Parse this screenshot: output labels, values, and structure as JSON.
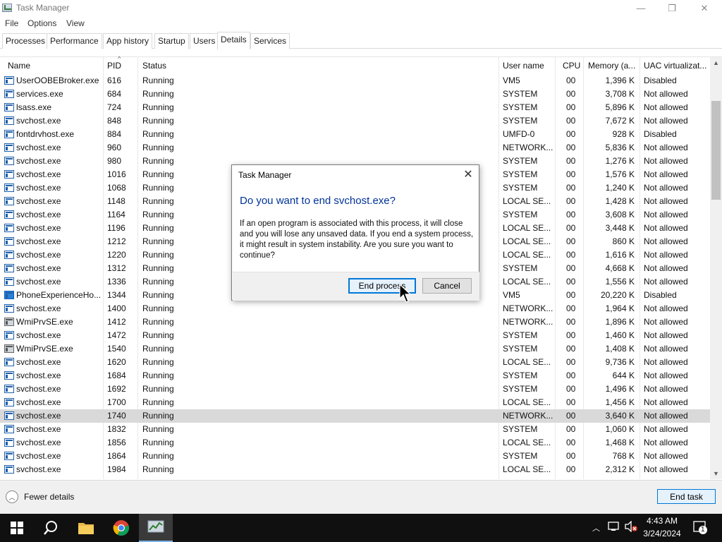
{
  "window": {
    "title": "Task Manager",
    "minimize": "—",
    "restore": "❐",
    "close": "✕"
  },
  "menu": [
    "File",
    "Options",
    "View"
  ],
  "tabs": [
    "Processes",
    "Performance",
    "App history",
    "Startup",
    "Users",
    "Details",
    "Services"
  ],
  "active_tab": "Details",
  "columns": {
    "name": "Name",
    "pid": "PID",
    "status": "Status",
    "user": "User name",
    "cpu": "CPU",
    "memory": "Memory (a...",
    "uac": "UAC virtualizat..."
  },
  "rows": [
    {
      "name": "UserOOBEBroker.exe",
      "pid": "616",
      "status": "Running",
      "user": "VM5",
      "cpu": "00",
      "memory": "1,396 K",
      "uac": "Disabled"
    },
    {
      "name": "services.exe",
      "pid": "684",
      "status": "Running",
      "user": "SYSTEM",
      "cpu": "00",
      "memory": "3,708 K",
      "uac": "Not allowed"
    },
    {
      "name": "lsass.exe",
      "pid": "724",
      "status": "Running",
      "user": "SYSTEM",
      "cpu": "00",
      "memory": "5,896 K",
      "uac": "Not allowed"
    },
    {
      "name": "svchost.exe",
      "pid": "848",
      "status": "Running",
      "user": "SYSTEM",
      "cpu": "00",
      "memory": "7,672 K",
      "uac": "Not allowed"
    },
    {
      "name": "fontdrvhost.exe",
      "pid": "884",
      "status": "Running",
      "user": "UMFD-0",
      "cpu": "00",
      "memory": "928 K",
      "uac": "Disabled"
    },
    {
      "name": "svchost.exe",
      "pid": "960",
      "status": "Running",
      "user": "NETWORK...",
      "cpu": "00",
      "memory": "5,836 K",
      "uac": "Not allowed"
    },
    {
      "name": "svchost.exe",
      "pid": "980",
      "status": "Running",
      "user": "SYSTEM",
      "cpu": "00",
      "memory": "1,276 K",
      "uac": "Not allowed"
    },
    {
      "name": "svchost.exe",
      "pid": "1016",
      "status": "Running",
      "user": "SYSTEM",
      "cpu": "00",
      "memory": "1,576 K",
      "uac": "Not allowed"
    },
    {
      "name": "svchost.exe",
      "pid": "1068",
      "status": "Running",
      "user": "SYSTEM",
      "cpu": "00",
      "memory": "1,240 K",
      "uac": "Not allowed"
    },
    {
      "name": "svchost.exe",
      "pid": "1148",
      "status": "Running",
      "user": "LOCAL SE...",
      "cpu": "00",
      "memory": "1,428 K",
      "uac": "Not allowed"
    },
    {
      "name": "svchost.exe",
      "pid": "1164",
      "status": "Running",
      "user": "SYSTEM",
      "cpu": "00",
      "memory": "3,608 K",
      "uac": "Not allowed"
    },
    {
      "name": "svchost.exe",
      "pid": "1196",
      "status": "Running",
      "user": "LOCAL SE...",
      "cpu": "00",
      "memory": "3,448 K",
      "uac": "Not allowed"
    },
    {
      "name": "svchost.exe",
      "pid": "1212",
      "status": "Running",
      "user": "LOCAL SE...",
      "cpu": "00",
      "memory": "860 K",
      "uac": "Not allowed"
    },
    {
      "name": "svchost.exe",
      "pid": "1220",
      "status": "Running",
      "user": "LOCAL SE...",
      "cpu": "00",
      "memory": "1,616 K",
      "uac": "Not allowed"
    },
    {
      "name": "svchost.exe",
      "pid": "1312",
      "status": "Running",
      "user": "SYSTEM",
      "cpu": "00",
      "memory": "4,668 K",
      "uac": "Not allowed"
    },
    {
      "name": "svchost.exe",
      "pid": "1336",
      "status": "Running",
      "user": "LOCAL SE...",
      "cpu": "00",
      "memory": "1,556 K",
      "uac": "Not allowed"
    },
    {
      "name": "PhoneExperienceHo...",
      "pid": "1344",
      "status": "Running",
      "user": "VM5",
      "cpu": "00",
      "memory": "20,220 K",
      "uac": "Disabled",
      "icon": "phone"
    },
    {
      "name": "svchost.exe",
      "pid": "1400",
      "status": "Running",
      "user": "NETWORK...",
      "cpu": "00",
      "memory": "1,964 K",
      "uac": "Not allowed"
    },
    {
      "name": "WmiPrvSE.exe",
      "pid": "1412",
      "status": "Running",
      "user": "NETWORK...",
      "cpu": "00",
      "memory": "1,896 K",
      "uac": "Not allowed",
      "icon": "wmi"
    },
    {
      "name": "svchost.exe",
      "pid": "1472",
      "status": "Running",
      "user": "SYSTEM",
      "cpu": "00",
      "memory": "1,460 K",
      "uac": "Not allowed"
    },
    {
      "name": "WmiPrvSE.exe",
      "pid": "1540",
      "status": "Running",
      "user": "SYSTEM",
      "cpu": "00",
      "memory": "1,408 K",
      "uac": "Not allowed",
      "icon": "wmi"
    },
    {
      "name": "svchost.exe",
      "pid": "1620",
      "status": "Running",
      "user": "LOCAL SE...",
      "cpu": "00",
      "memory": "9,736 K",
      "uac": "Not allowed"
    },
    {
      "name": "svchost.exe",
      "pid": "1684",
      "status": "Running",
      "user": "SYSTEM",
      "cpu": "00",
      "memory": "644 K",
      "uac": "Not allowed"
    },
    {
      "name": "svchost.exe",
      "pid": "1692",
      "status": "Running",
      "user": "SYSTEM",
      "cpu": "00",
      "memory": "1,496 K",
      "uac": "Not allowed"
    },
    {
      "name": "svchost.exe",
      "pid": "1700",
      "status": "Running",
      "user": "LOCAL SE...",
      "cpu": "00",
      "memory": "1,456 K",
      "uac": "Not allowed"
    },
    {
      "name": "svchost.exe",
      "pid": "1740",
      "status": "Running",
      "user": "NETWORK...",
      "cpu": "00",
      "memory": "3,640 K",
      "uac": "Not allowed",
      "selected": true
    },
    {
      "name": "svchost.exe",
      "pid": "1832",
      "status": "Running",
      "user": "SYSTEM",
      "cpu": "00",
      "memory": "1,060 K",
      "uac": "Not allowed"
    },
    {
      "name": "svchost.exe",
      "pid": "1856",
      "status": "Running",
      "user": "LOCAL SE...",
      "cpu": "00",
      "memory": "1,468 K",
      "uac": "Not allowed"
    },
    {
      "name": "svchost.exe",
      "pid": "1864",
      "status": "Running",
      "user": "SYSTEM",
      "cpu": "00",
      "memory": "768 K",
      "uac": "Not allowed"
    },
    {
      "name": "svchost.exe",
      "pid": "1984",
      "status": "Running",
      "user": "LOCAL SE...",
      "cpu": "00",
      "memory": "2,312 K",
      "uac": "Not allowed"
    }
  ],
  "footer": {
    "fewer_details": "Fewer details",
    "end_task": "End task"
  },
  "dialog": {
    "title": "Task Manager",
    "heading": "Do you want to end svchost.exe?",
    "message": "If an open program is associated with this process, it will close and you will lose any unsaved data. If you end a system process, it might result in system instability. Are you sure you want to continue?",
    "end_process": "End process",
    "cancel": "Cancel"
  },
  "taskbar": {
    "time": "4:43 AM",
    "date": "3/24/2024",
    "notification_count": "1"
  },
  "colors": {
    "accent": "#0078d7",
    "heading_blue": "#003399",
    "selected_row": "#d9d9d9",
    "taskbar": "#101010"
  }
}
